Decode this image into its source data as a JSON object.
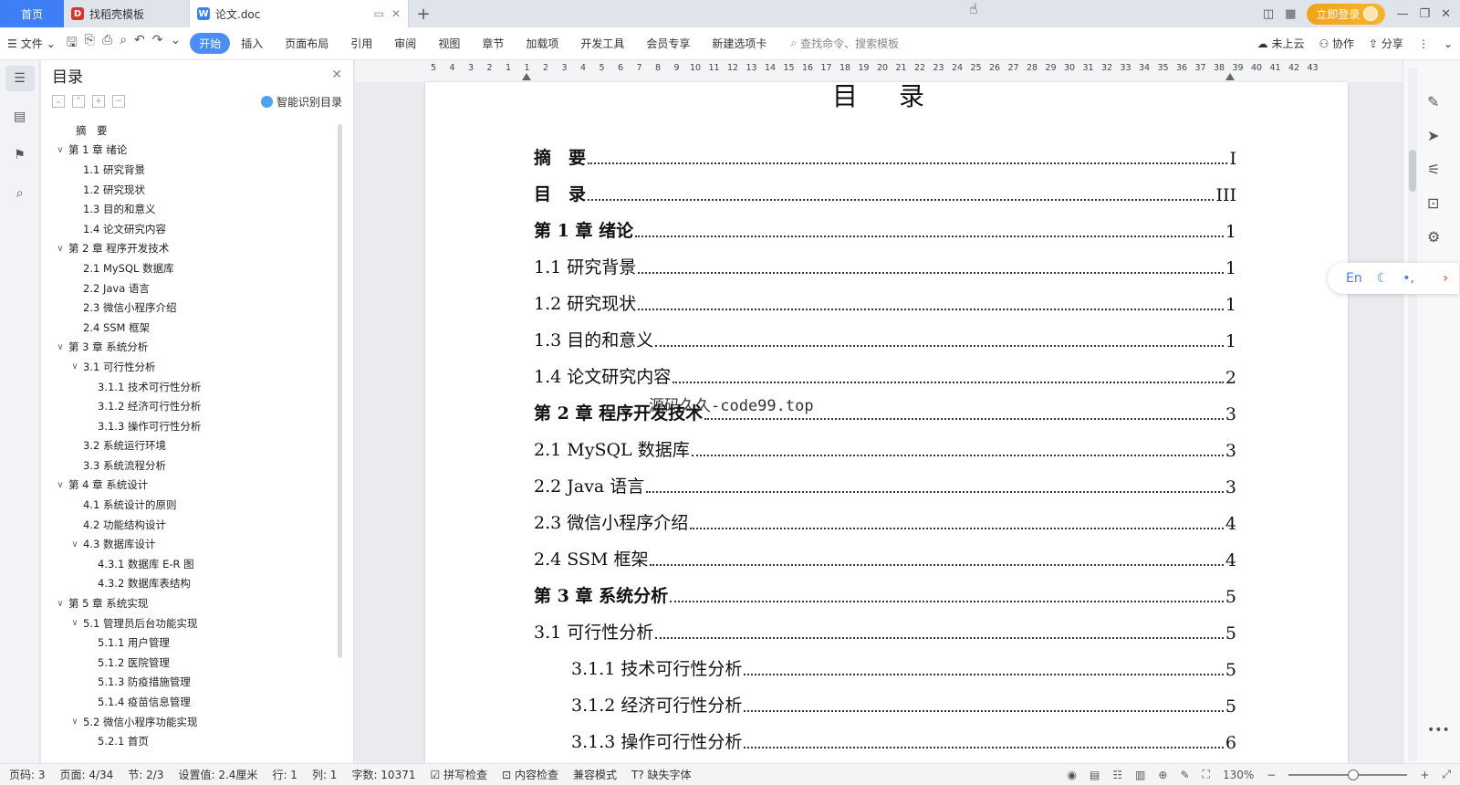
{
  "tabs": {
    "home": "首页",
    "items": [
      {
        "label": "找稻壳模板",
        "icon_color": "#d9342b",
        "icon_glyph": "D",
        "active": false
      },
      {
        "label": "论文.doc",
        "icon_color": "#3e7ef7",
        "icon_glyph": "W",
        "active": true
      }
    ],
    "add": "+",
    "login": "立即登录"
  },
  "toolbar": {
    "file": "文件",
    "menus": [
      "开始",
      "插入",
      "页面布局",
      "引用",
      "审阅",
      "视图",
      "章节",
      "加载项",
      "开发工具",
      "会员专享",
      "新建选项卡"
    ],
    "active_menu": "开始",
    "search_placeholder": "查找命令、搜索模板",
    "cloud": "未上云",
    "collab": "协作",
    "share": "分享"
  },
  "outline": {
    "title": "目录",
    "smart": "智能识别目录",
    "items": [
      {
        "label": "摘　要",
        "level": 1,
        "chev": ""
      },
      {
        "label": "第 1 章  绪论",
        "level": 1,
        "chev": "v"
      },
      {
        "label": "1.1  研究背景",
        "level": 2,
        "chev": ""
      },
      {
        "label": "1.2  研究现状",
        "level": 2,
        "chev": ""
      },
      {
        "label": "1.3  目的和意义",
        "level": 2,
        "chev": ""
      },
      {
        "label": "1.4  论文研究内容",
        "level": 2,
        "chev": ""
      },
      {
        "label": "第 2 章  程序开发技术",
        "level": 1,
        "chev": "v"
      },
      {
        "label": "2.1 MySQL 数据库",
        "level": 2,
        "chev": ""
      },
      {
        "label": "2.2 Java 语言",
        "level": 2,
        "chev": ""
      },
      {
        "label": "2.3  微信小程序介绍",
        "level": 2,
        "chev": ""
      },
      {
        "label": "2.4 SSM 框架",
        "level": 2,
        "chev": ""
      },
      {
        "label": "第 3 章  系统分析",
        "level": 1,
        "chev": "v"
      },
      {
        "label": "3.1 可行性分析",
        "level": 2,
        "chev": "v"
      },
      {
        "label": "3.1.1 技术可行性分析",
        "level": 3,
        "chev": ""
      },
      {
        "label": "3.1.2 经济可行性分析",
        "level": 3,
        "chev": ""
      },
      {
        "label": "3.1.3 操作可行性分析",
        "level": 3,
        "chev": ""
      },
      {
        "label": "3.2 系统运行环境",
        "level": 2,
        "chev": ""
      },
      {
        "label": "3.3 系统流程分析",
        "level": 2,
        "chev": ""
      },
      {
        "label": "第 4 章  系统设计",
        "level": 1,
        "chev": "v"
      },
      {
        "label": "4.1  系统设计的原则",
        "level": 2,
        "chev": ""
      },
      {
        "label": "4.2  功能结构设计",
        "level": 2,
        "chev": ""
      },
      {
        "label": "4.3  数据库设计",
        "level": 2,
        "chev": "v"
      },
      {
        "label": "4.3.1  数据库 E-R 图",
        "level": 3,
        "chev": ""
      },
      {
        "label": "4.3.2  数据库表结构",
        "level": 3,
        "chev": ""
      },
      {
        "label": "第 5 章  系统实现",
        "level": 1,
        "chev": "v"
      },
      {
        "label": "5.1 管理员后台功能实现",
        "level": 2,
        "chev": "v"
      },
      {
        "label": "5.1.1  用户管理",
        "level": 3,
        "chev": ""
      },
      {
        "label": "5.1.2  医院管理",
        "level": 3,
        "chev": ""
      },
      {
        "label": "5.1.3  防疫措施管理",
        "level": 3,
        "chev": ""
      },
      {
        "label": "5.1.4  疫苗信息管理",
        "level": 3,
        "chev": ""
      },
      {
        "label": "5.2  微信小程序功能实现",
        "level": 2,
        "chev": "v"
      },
      {
        "label": "5.2.1  首页",
        "level": 3,
        "chev": ""
      }
    ]
  },
  "ruler": {
    "labels": [
      "5",
      "4",
      "3",
      "2",
      "1",
      "1",
      "2",
      "3",
      "4",
      "5",
      "6",
      "7",
      "8",
      "9",
      "10",
      "11",
      "12",
      "13",
      "14",
      "15",
      "16",
      "17",
      "18",
      "19",
      "20",
      "21",
      "22",
      "23",
      "24",
      "25",
      "26",
      "27",
      "28",
      "29",
      "30",
      "31",
      "32",
      "33",
      "34",
      "35",
      "36",
      "37",
      "38",
      "39",
      "40",
      "41",
      "42",
      "43"
    ]
  },
  "document": {
    "title": "目  录",
    "watermark": "源码久久-code99.top",
    "toc": [
      {
        "text": "摘　要",
        "page": "I",
        "indent": 0,
        "bold": true
      },
      {
        "text": "目　录",
        "page": "III",
        "indent": 0,
        "bold": true
      },
      {
        "text": "第 1 章  绪论",
        "page": "1",
        "indent": 0,
        "bold": true
      },
      {
        "text": "1.1  研究背景",
        "page": "1",
        "indent": 0,
        "bold": false
      },
      {
        "text": "1.2  研究现状",
        "page": "1",
        "indent": 0,
        "bold": false
      },
      {
        "text": "1.3  目的和意义",
        "page": "1",
        "indent": 0,
        "bold": false
      },
      {
        "text": "1.4  论文研究内容",
        "page": "2",
        "indent": 0,
        "bold": false
      },
      {
        "text": "第 2 章  程序开发技术",
        "page": "3",
        "indent": 0,
        "bold": true
      },
      {
        "text": "2.1 MySQL 数据库",
        "page": "3",
        "indent": 0,
        "bold": false
      },
      {
        "text": "2.2 Java 语言",
        "page": "3",
        "indent": 0,
        "bold": false
      },
      {
        "text": "2.3  微信小程序介绍",
        "page": "4",
        "indent": 0,
        "bold": false
      },
      {
        "text": "2.4 SSM 框架",
        "page": "4",
        "indent": 0,
        "bold": false
      },
      {
        "text": "第 3 章  系统分析",
        "page": "5",
        "indent": 0,
        "bold": true
      },
      {
        "text": "3.1 可行性分析",
        "page": "5",
        "indent": 0,
        "bold": false
      },
      {
        "text": "3.1.1 技术可行性分析",
        "page": "5",
        "indent": 1,
        "bold": false
      },
      {
        "text": "3.1.2 经济可行性分析",
        "page": "5",
        "indent": 1,
        "bold": false
      },
      {
        "text": "3.1.3 操作可行性分析",
        "page": "6",
        "indent": 1,
        "bold": false
      }
    ]
  },
  "floating_bar": {
    "lang": "En"
  },
  "statusbar": {
    "page_code": "页码: 3",
    "page": "页面: 4/34",
    "section": "节: 2/3",
    "setting": "设置值: 2.4厘米",
    "row": "行: 1",
    "col": "列: 1",
    "words": "字数: 10371",
    "spell": "拼写检查",
    "content_check": "内容检查",
    "compat": "兼容模式",
    "missing_font": "缺失字体",
    "zoom": "130%",
    "zoom_level": 0.54
  }
}
